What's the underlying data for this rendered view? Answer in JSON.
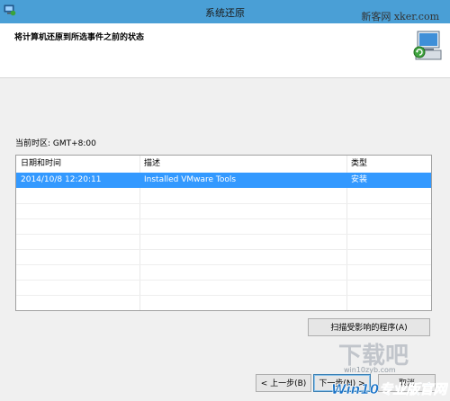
{
  "window": {
    "title": "系统还原",
    "watermark": "新客网 xker.com"
  },
  "header": {
    "heading": "将计算机还原到所选事件之前的状态"
  },
  "timezone_label": "当前时区: GMT+8:00",
  "table": {
    "columns": [
      "日期和时间",
      "描述",
      "类型"
    ],
    "rows": [
      {
        "datetime": "2014/10/8 12:20:11",
        "description": "Installed VMware Tools",
        "type": "安装",
        "selected": true
      }
    ]
  },
  "buttons": {
    "scan": "扫描受影响的程序(A)",
    "back": "< 上一步(B)",
    "next": "下一步(N) >",
    "cancel": "取消"
  },
  "brand_watermark": {
    "text": "Win10专业版官网",
    "url": "win10zyb.com"
  },
  "colors": {
    "titlebar": "#4a9fd6",
    "selection": "#3399ff"
  }
}
